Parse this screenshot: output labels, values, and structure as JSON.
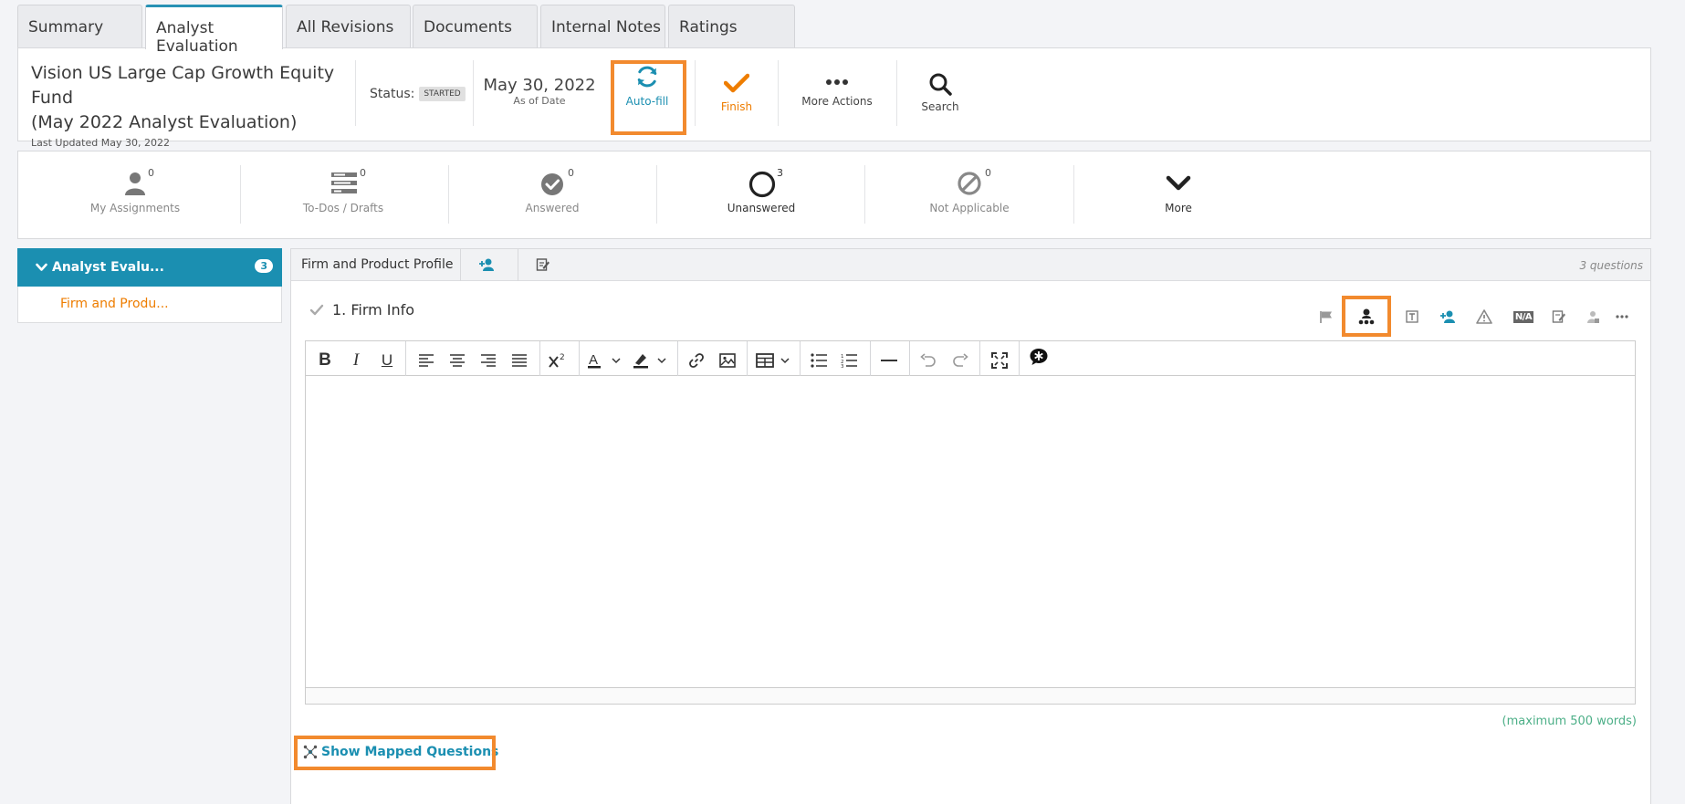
{
  "tabs": [
    {
      "label": "Summary"
    },
    {
      "label": "Analyst Evaluation"
    },
    {
      "label": "All Revisions"
    },
    {
      "label": "Documents"
    },
    {
      "label": "Internal Notes"
    },
    {
      "label": "Ratings"
    }
  ],
  "header": {
    "title_line1": "Vision US Large Cap Growth Equity Fund",
    "title_line2": "(May 2022 Analyst Evaluation)",
    "last_updated": "Last Updated May 30, 2022",
    "status_label": "Status:",
    "status_value": "STARTED",
    "date": "May 30, 2022",
    "date_caption": "As of Date",
    "actions": {
      "autofill": "Auto-fill",
      "finish": "Finish",
      "more_actions": "More Actions",
      "search": "Search"
    }
  },
  "stats": [
    {
      "label": "My Assignments",
      "count": "0"
    },
    {
      "label": "To-Dos / Drafts",
      "count": "0"
    },
    {
      "label": "Answered",
      "count": "0"
    },
    {
      "label": "Unanswered",
      "count": "3"
    },
    {
      "label": "Not Applicable",
      "count": "0"
    },
    {
      "label": "More",
      "count": ""
    }
  ],
  "sidebar": {
    "section_label": "Analyst Evalu...",
    "section_count": "3",
    "item_label": "Firm and Produ..."
  },
  "content": {
    "section_title": "Firm and Product Profile",
    "question_count": "3 questions",
    "question_title": "1. Firm Info",
    "na_label": "N/A",
    "word_limit": "(maximum 500 words)",
    "show_mapped": "Show Mapped Questions"
  },
  "colors": {
    "accent": "#1b8fb1",
    "highlight": "#f28a2e",
    "orange_text": "#ee7d00",
    "green_text": "#4caf87"
  }
}
